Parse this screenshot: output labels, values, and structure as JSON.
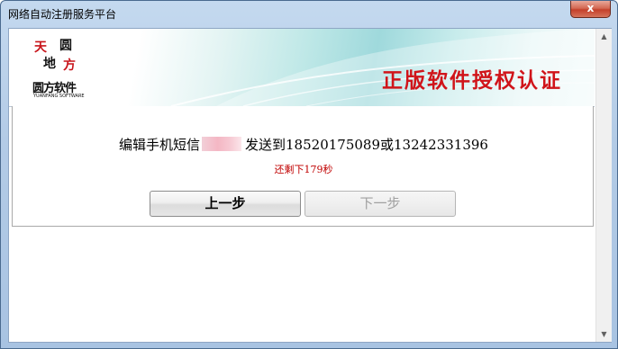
{
  "window": {
    "title": "网络自动注册服务平台",
    "close_glyph": "x"
  },
  "banner": {
    "title": "正版软件授权认证",
    "logo": {
      "chars": [
        "天",
        "圆",
        "地",
        "方"
      ],
      "name": "圆方软件",
      "subtitle": "YUANFANG SOFTWARE"
    }
  },
  "message": {
    "prefix": "编辑手机短信",
    "suffix": "发送到18520175089或13242331396",
    "redacted_code": true
  },
  "countdown": "还剩下179秒",
  "buttons": {
    "prev": "上一步",
    "next": "下一步",
    "next_enabled": false
  },
  "scrollbar": {
    "up_glyph": "▲",
    "down_glyph": "▼"
  },
  "colors": {
    "title_red": "#d0141a",
    "countdown_red": "#c00000",
    "close_red": "#c4402a"
  }
}
